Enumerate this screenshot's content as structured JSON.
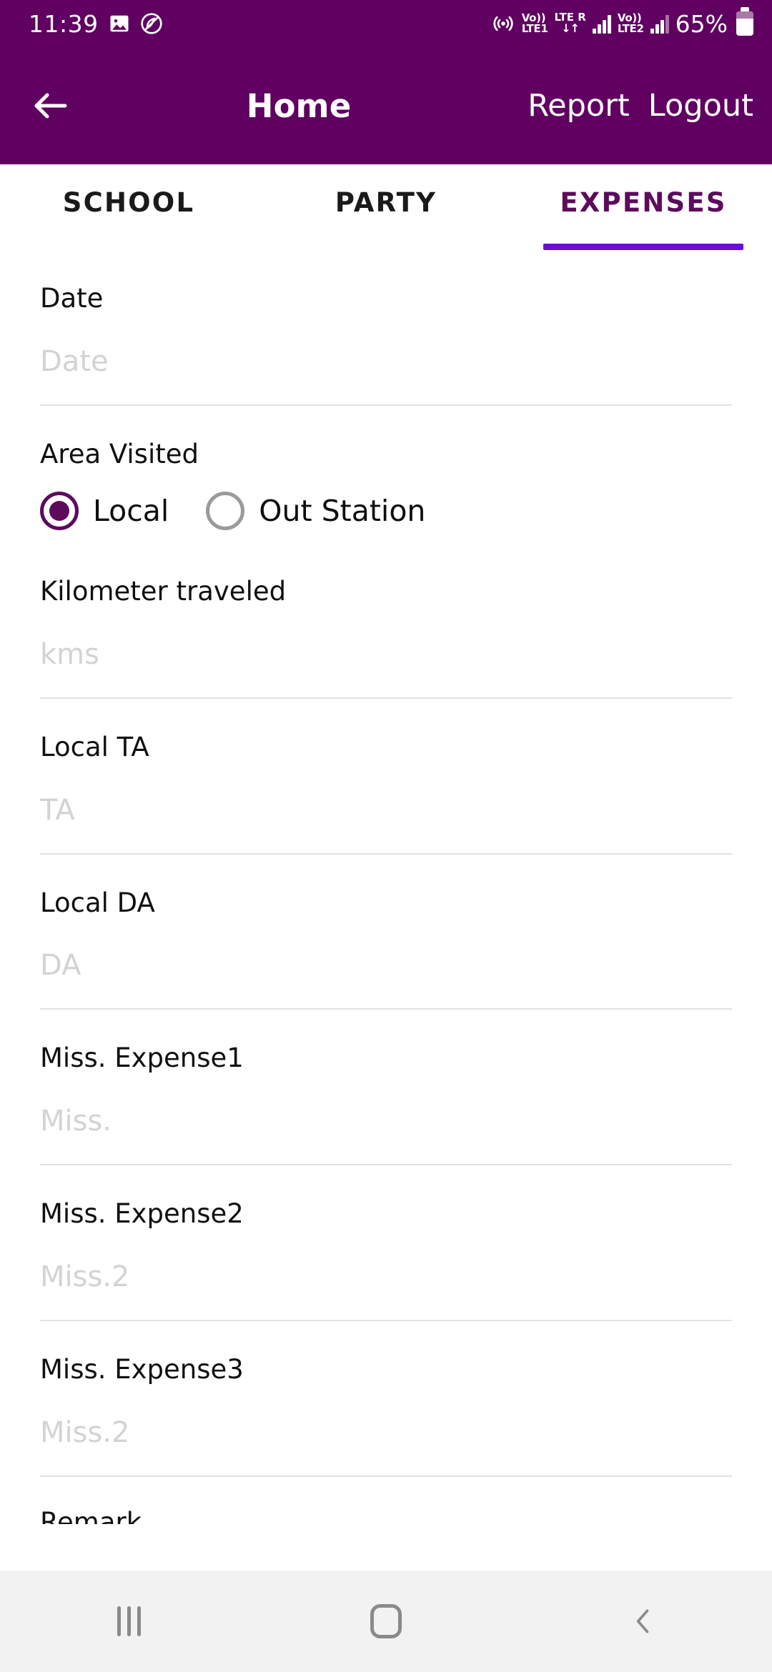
{
  "status_bar": {
    "time": "11:39",
    "icons_left": [
      "image-icon",
      "samsung-members-icon"
    ],
    "icons_right": [
      "hotspot-icon",
      "volte1-icon",
      "lte-roaming-icon",
      "signal-bars-sim1",
      "volte2-icon",
      "signal-bars-sim2"
    ],
    "volte1_top": "Vo))",
    "volte1_bottom": "LTE1",
    "lte_top": "LTE",
    "lte_roaming": "R",
    "data_arrows": "↓↑",
    "volte2_top": "Vo))",
    "volte2_bottom": "LTE2",
    "battery_percent": "65%"
  },
  "appbar": {
    "back_icon": "arrow-left-icon",
    "title": "Home",
    "actions": [
      {
        "label": "Report"
      },
      {
        "label": "Logout"
      }
    ],
    "background": "#600060"
  },
  "tabs": {
    "items": [
      {
        "label": "SCHOOL",
        "active": false
      },
      {
        "label": "PARTY",
        "active": false
      },
      {
        "label": "EXPENSES",
        "active": true
      }
    ],
    "active_color": "#5d0a5d",
    "indicator_color": "#6a0ddd"
  },
  "form": {
    "fields": [
      {
        "label": "Date",
        "placeholder": "Date",
        "value": ""
      },
      {
        "label": "Kilometer traveled",
        "placeholder": "kms",
        "value": ""
      },
      {
        "label": "Local TA",
        "placeholder": "TA",
        "value": ""
      },
      {
        "label": "Local DA",
        "placeholder": "DA",
        "value": ""
      },
      {
        "label": "Miss. Expense1",
        "placeholder": "Miss.",
        "value": ""
      },
      {
        "label": "Miss. Expense2",
        "placeholder": "Miss.2",
        "value": ""
      },
      {
        "label": "Miss. Expense3",
        "placeholder": "Miss.2",
        "value": ""
      }
    ],
    "area_visited": {
      "label": "Area Visited",
      "options": [
        {
          "label": "Local",
          "selected": true
        },
        {
          "label": "Out Station",
          "selected": false
        }
      ]
    },
    "partial_field_label": "Remark"
  },
  "navbar": {
    "recents_icon": "recents-icon",
    "home_icon": "home-icon",
    "back_icon": "chevron-left-icon"
  }
}
